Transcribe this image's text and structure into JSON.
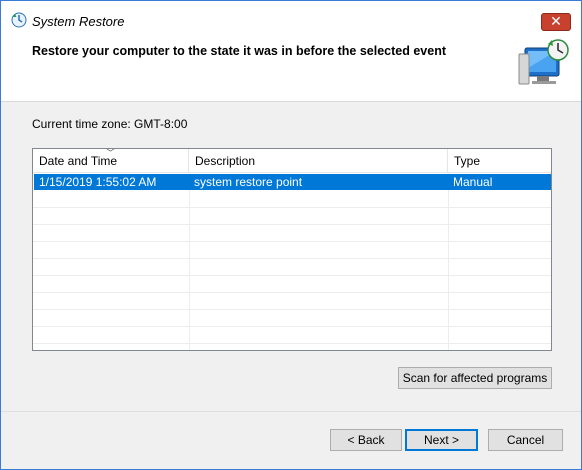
{
  "window": {
    "title": "System Restore",
    "close_label": "✕"
  },
  "header": {
    "text": "Restore your computer to the state it was in before the selected event"
  },
  "timezone": "Current time zone: GMT-8:00",
  "table": {
    "columns": [
      "Date and Time",
      "Description",
      "Type"
    ],
    "rows": [
      {
        "date": "1/15/2019 1:55:02 AM",
        "description": "system restore point",
        "type": "Manual",
        "selected": true
      }
    ]
  },
  "buttons": {
    "scan": "Scan for affected programs",
    "back": "< Back",
    "next": "Next >",
    "cancel": "Cancel"
  },
  "colors": {
    "selection": "#0078d7",
    "close": "#c8402e"
  }
}
